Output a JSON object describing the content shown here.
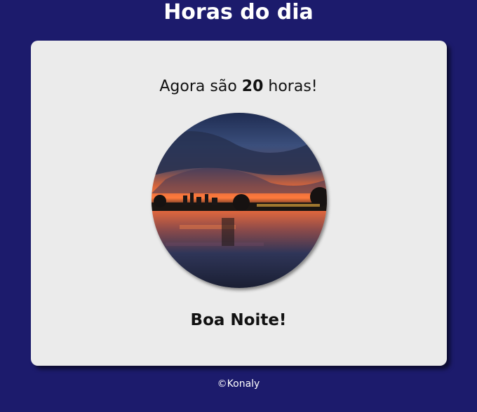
{
  "header": {
    "title": "Horas do dia"
  },
  "card": {
    "message_prefix": "Agora são",
    "hour": "20",
    "message_suffix": "horas!",
    "image_icon": "night-sunset-lake-photo",
    "greeting": "Boa Noite!"
  },
  "footer": {
    "text": "©Konaly"
  },
  "colors": {
    "page_background": "#1c1b6c",
    "card_background": "#ebebeb",
    "title_text": "#ffffff",
    "body_text": "#111111"
  }
}
